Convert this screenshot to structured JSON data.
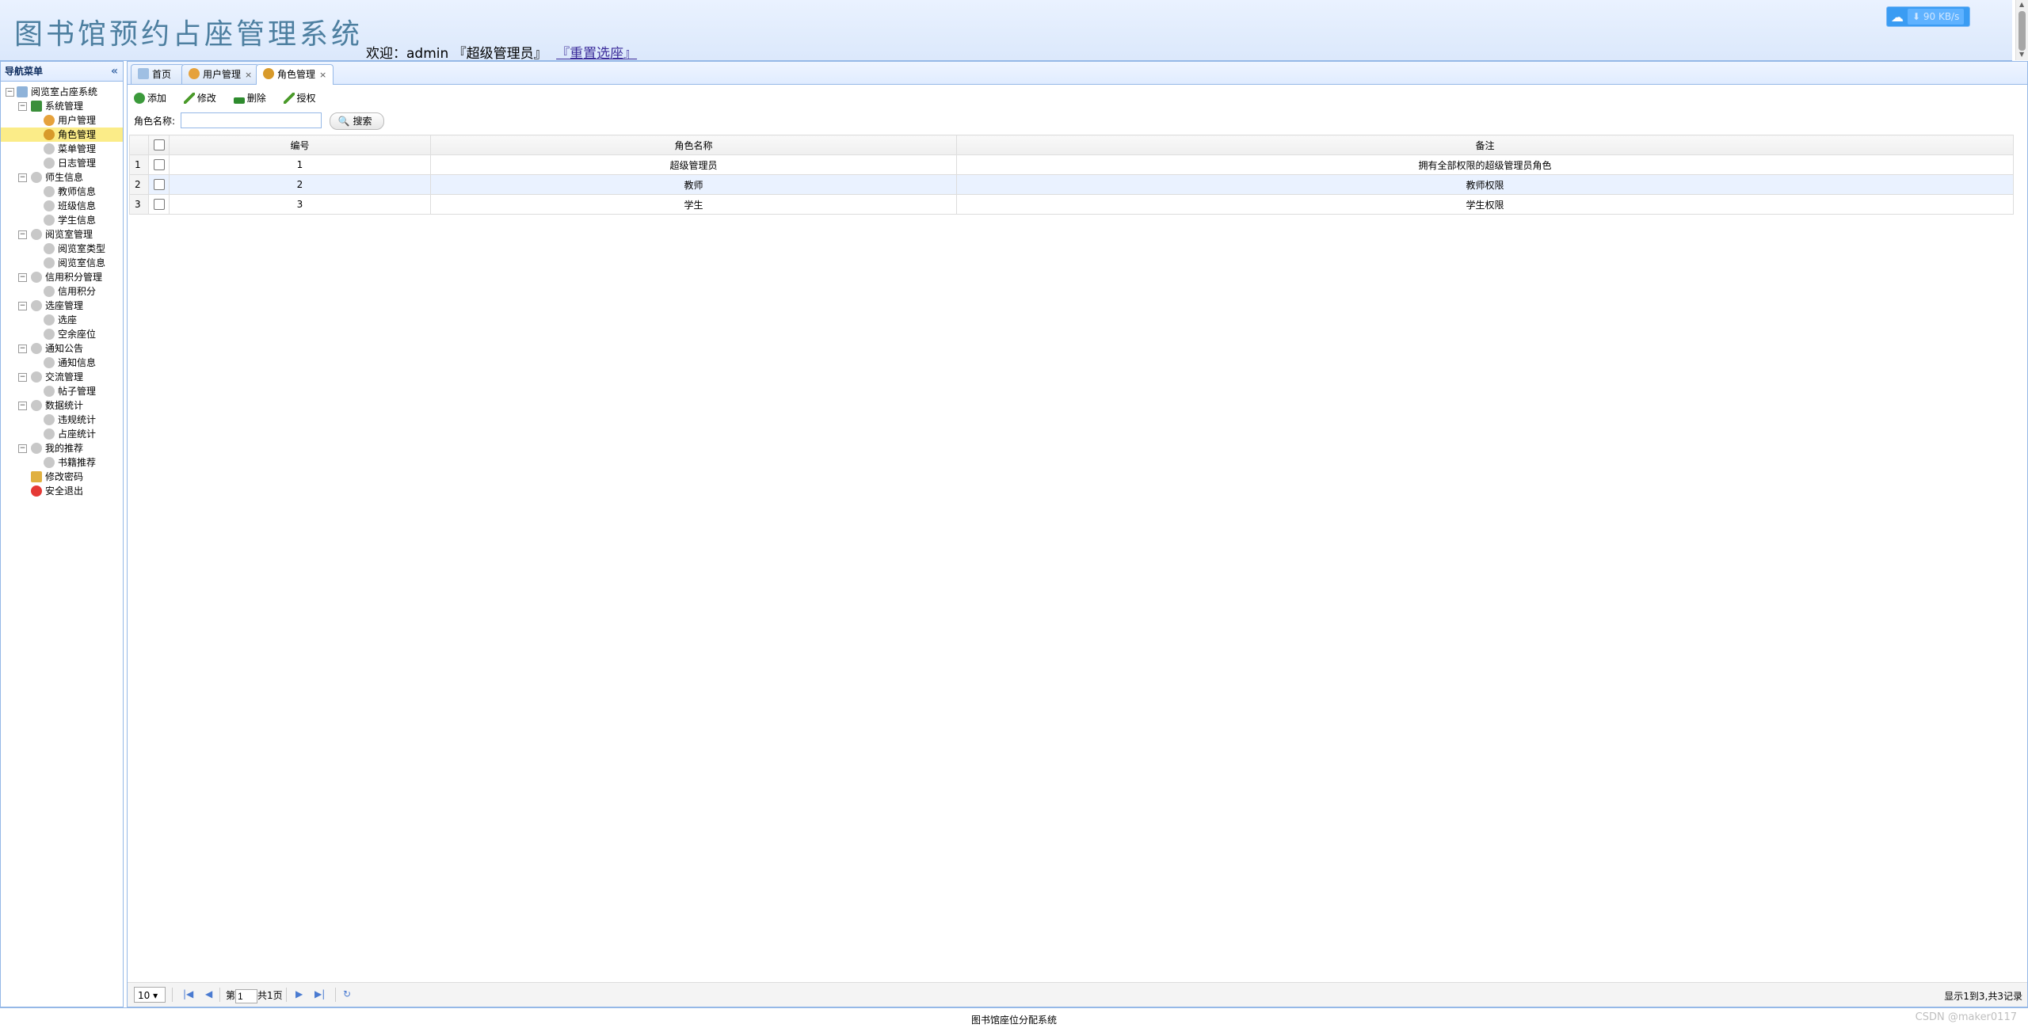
{
  "header": {
    "title": "图书馆预约占座管理系统",
    "welcome_prefix": "欢迎：",
    "username": "admin",
    "role_text": "『超级管理员』",
    "reset_link": "『重置选座』",
    "net_speed": "90 KB/s"
  },
  "sidebar": {
    "title": "导航菜单",
    "collapse_icon": "«",
    "root": "阅览室占座系统",
    "items": [
      {
        "label": "系统管理"
      },
      {
        "label": "用户管理"
      },
      {
        "label": "角色管理"
      },
      {
        "label": "菜单管理"
      },
      {
        "label": "日志管理"
      },
      {
        "label": "师生信息"
      },
      {
        "label": "教师信息"
      },
      {
        "label": "班级信息"
      },
      {
        "label": "学生信息"
      },
      {
        "label": "阅览室管理"
      },
      {
        "label": "阅览室类型"
      },
      {
        "label": "阅览室信息"
      },
      {
        "label": "信用积分管理"
      },
      {
        "label": "信用积分"
      },
      {
        "label": "选座管理"
      },
      {
        "label": "选座"
      },
      {
        "label": "空余座位"
      },
      {
        "label": "通知公告"
      },
      {
        "label": "通知信息"
      },
      {
        "label": "交流管理"
      },
      {
        "label": "帖子管理"
      },
      {
        "label": "数据统计"
      },
      {
        "label": "违规统计"
      },
      {
        "label": "占座统计"
      },
      {
        "label": "我的推荐"
      },
      {
        "label": "书籍推荐"
      },
      {
        "label": "修改密码"
      },
      {
        "label": "安全退出"
      }
    ]
  },
  "tabs": [
    {
      "label": "首页"
    },
    {
      "label": "用户管理"
    },
    {
      "label": "角色管理"
    }
  ],
  "toolbar": {
    "add": "添加",
    "edit": "修改",
    "delete": "删除",
    "authorize": "授权"
  },
  "search": {
    "label": "角色名称:",
    "value": "",
    "button": "搜索"
  },
  "table": {
    "columns": [
      "编号",
      "角色名称",
      "备注"
    ],
    "rows": [
      {
        "rn": "1",
        "id": "1",
        "name": "超级管理员",
        "remark": "拥有全部权限的超级管理员角色"
      },
      {
        "rn": "2",
        "id": "2",
        "name": "教师",
        "remark": "教师权限"
      },
      {
        "rn": "3",
        "id": "3",
        "name": "学生",
        "remark": "学生权限"
      }
    ]
  },
  "pager": {
    "page_size": "10",
    "page_prefix": "第",
    "page": "1",
    "page_suffix": "共1页",
    "info": "显示1到3,共3记录"
  },
  "footer": {
    "text": "图书馆座位分配系统",
    "watermark": "CSDN @maker0117"
  }
}
